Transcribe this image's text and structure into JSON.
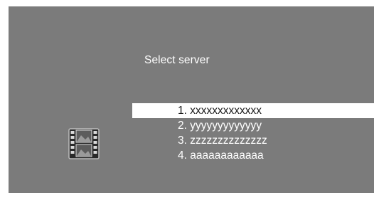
{
  "screen": {
    "title": "Select server",
    "selected_index": 0,
    "servers": [
      {
        "label": "1. xxxxxxxxxxxxx"
      },
      {
        "label": "2. yyyyyyyyyyyyy"
      },
      {
        "label": "3. zzzzzzzzzzzzzz"
      },
      {
        "label": "4. aaaaaaaaaaaa"
      }
    ],
    "icon": "film-reel-icon"
  },
  "colors": {
    "background": "#7b7b7b",
    "text": "#ffffff",
    "highlight": "#ffffff",
    "highlight_text": "#1a1a1a"
  }
}
